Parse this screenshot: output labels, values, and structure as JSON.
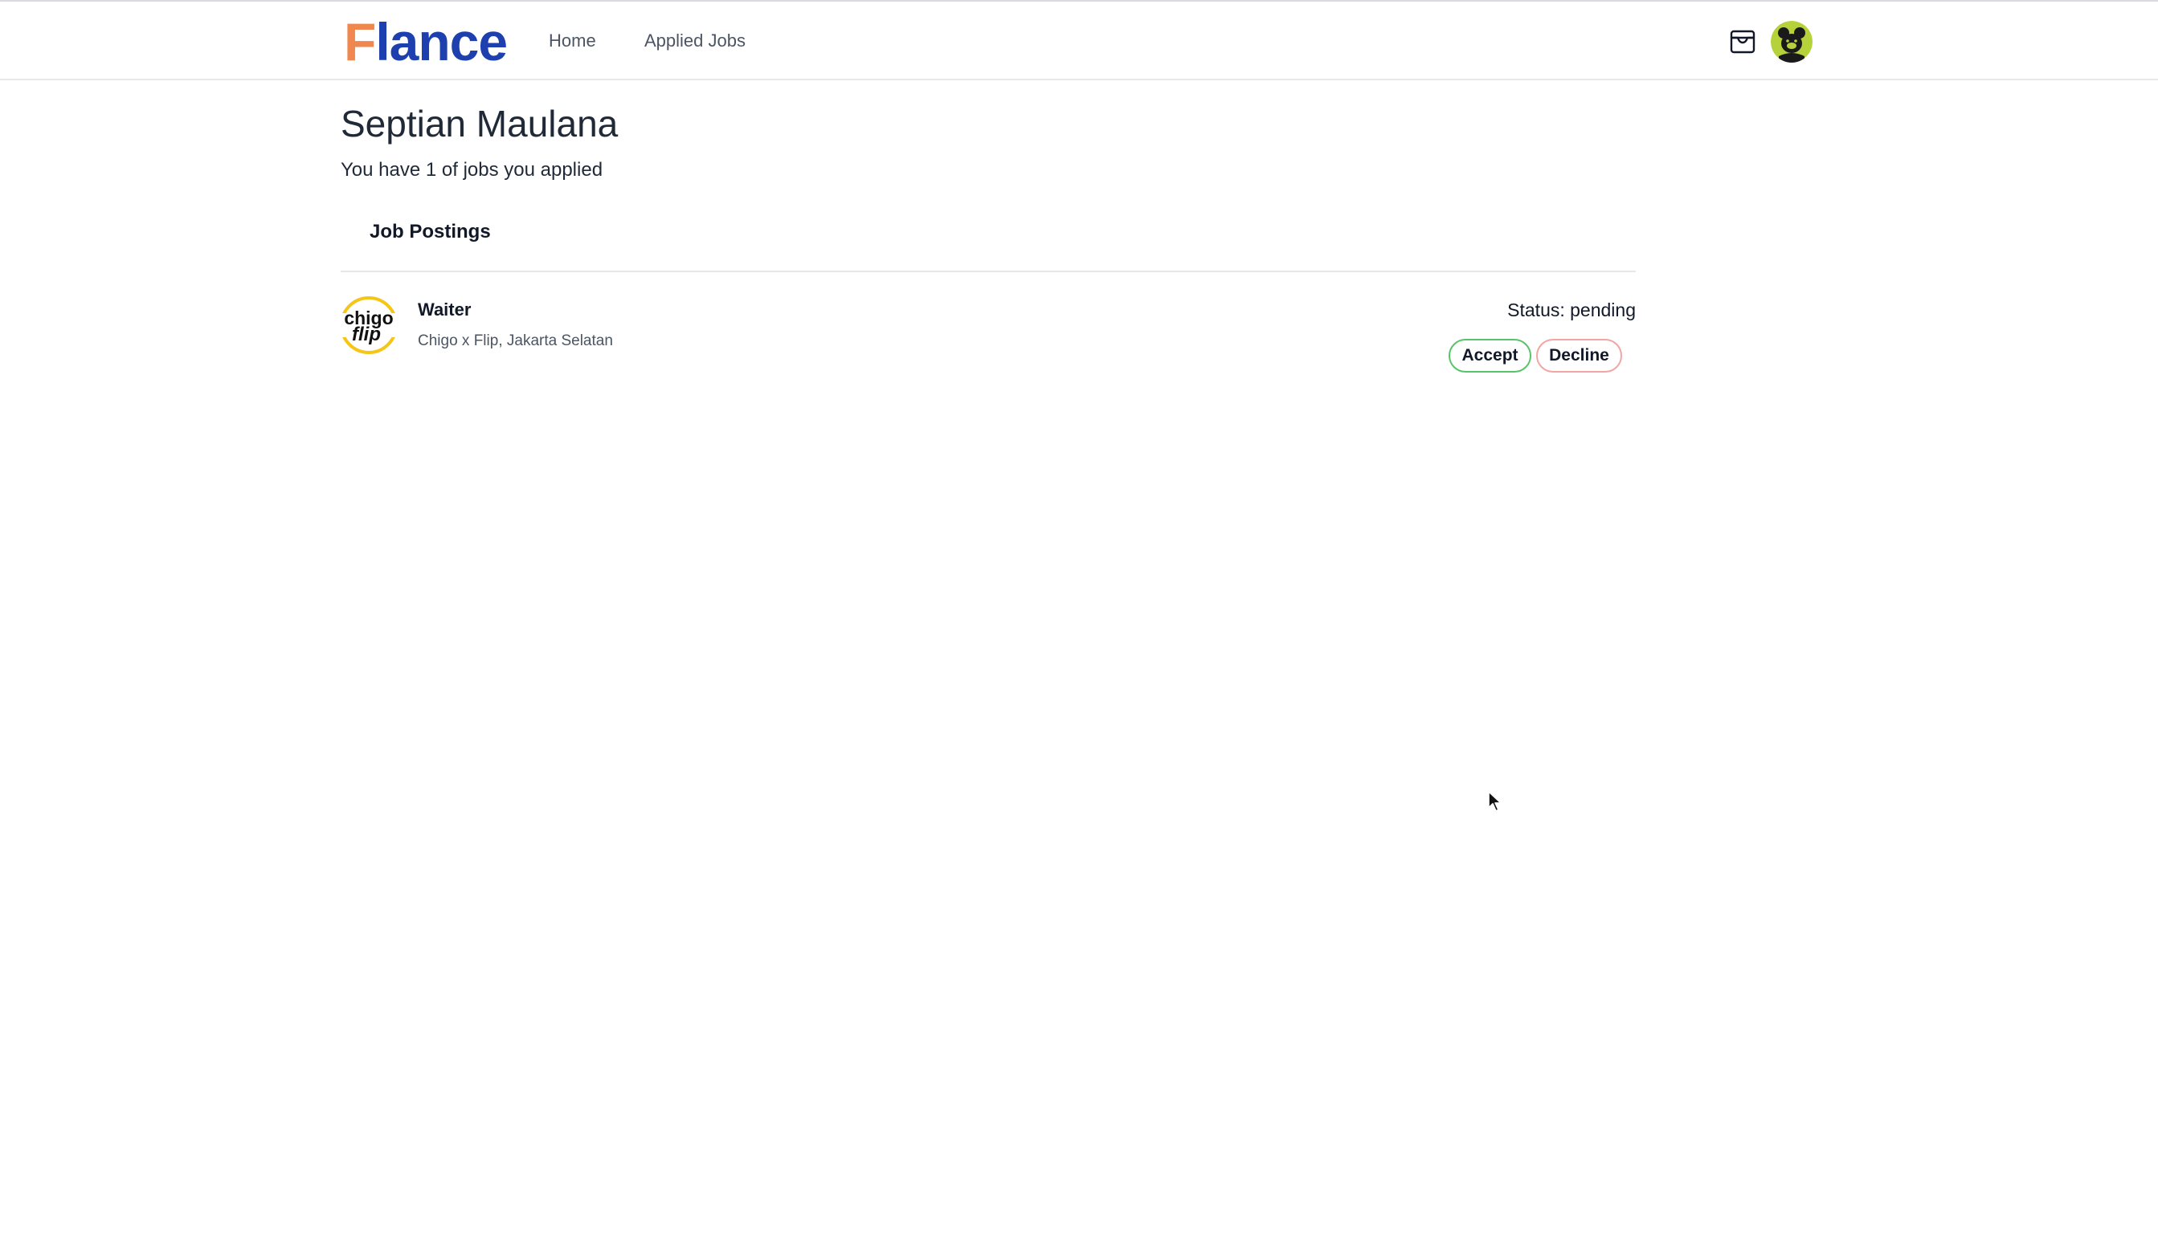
{
  "nav": {
    "logo_first": "F",
    "logo_rest": "lance",
    "links": [
      "Home",
      "Applied Jobs"
    ],
    "inbox_icon": "inbox-icon",
    "avatar_icon": "user-avatar"
  },
  "header": {
    "name": "Septian Maulana",
    "subtitle": "You have 1 of jobs you applied"
  },
  "section": {
    "title": "Job Postings"
  },
  "jobs": [
    {
      "title": "Waiter",
      "company": "Chigo x Flip, Jakarta Selatan",
      "logo_text_1": "chigo",
      "logo_text_2": "flip",
      "status": "Status: pending",
      "accept_label": "Accept",
      "decline_label": "Decline"
    }
  ],
  "colors": {
    "brand_orange": "#f0874f",
    "brand_blue": "#1e40af",
    "accept_border": "#58c46a",
    "decline_border": "#f2a5a5"
  }
}
